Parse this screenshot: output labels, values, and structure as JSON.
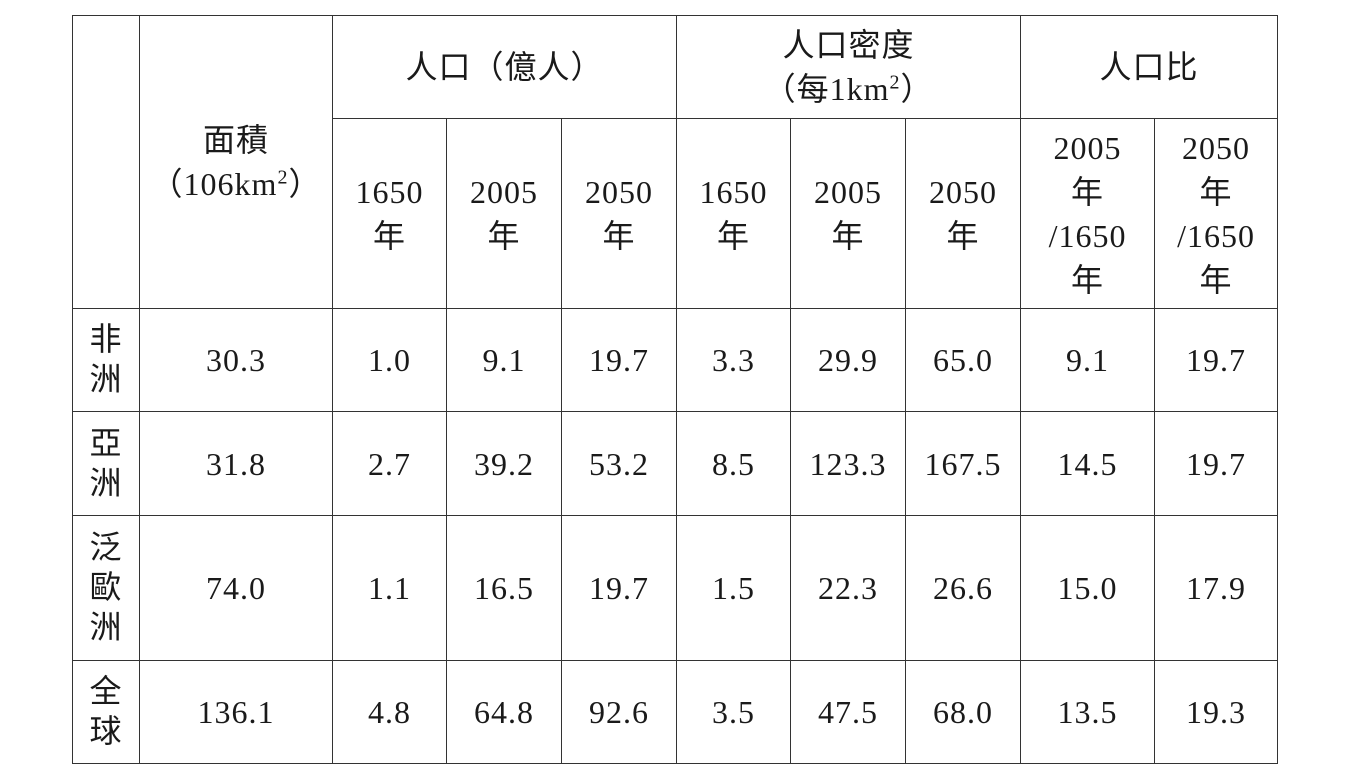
{
  "table": {
    "header": {
      "area": {
        "line1": "面積",
        "line2_pre": "（106km",
        "sup": "2",
        "line2_post": "）"
      },
      "population": "人口（億人）",
      "density": {
        "line1": "人口密度",
        "line2_pre": "（每1km",
        "sup": "2",
        "line2_post": "）"
      },
      "ratio": "人口比",
      "years": [
        {
          "year": "1650",
          "unit": "年"
        },
        {
          "year": "2005",
          "unit": "年"
        },
        {
          "year": "2050",
          "unit": "年"
        },
        {
          "year": "1650",
          "unit": "年"
        },
        {
          "year": "2005",
          "unit": "年"
        },
        {
          "year": "2050",
          "unit": "年"
        }
      ],
      "ratios": [
        {
          "l1": "2005",
          "l2": "年",
          "l3": "/1650",
          "l4": "年"
        },
        {
          "l1": "2050",
          "l2": "年",
          "l3": "/1650",
          "l4": "年"
        }
      ]
    },
    "rows": [
      {
        "region": [
          "非",
          "洲"
        ],
        "values": [
          "30.3",
          "1.0",
          "9.1",
          "19.7",
          "3.3",
          "29.9",
          "65.0",
          "9.1",
          "19.7"
        ]
      },
      {
        "region": [
          "亞",
          "洲"
        ],
        "values": [
          "31.8",
          "2.7",
          "39.2",
          "53.2",
          "8.5",
          "123.3",
          "167.5",
          "14.5",
          "19.7"
        ]
      },
      {
        "region": [
          "泛",
          "歐",
          "洲"
        ],
        "values": [
          "74.0",
          "1.1",
          "16.5",
          "19.7",
          "1.5",
          "22.3",
          "26.6",
          "15.0",
          "17.9"
        ]
      },
      {
        "region": [
          "全",
          "球"
        ],
        "values": [
          "136.1",
          "4.8",
          "64.8",
          "92.6",
          "3.5",
          "47.5",
          "68.0",
          "13.5",
          "19.3"
        ]
      }
    ]
  }
}
